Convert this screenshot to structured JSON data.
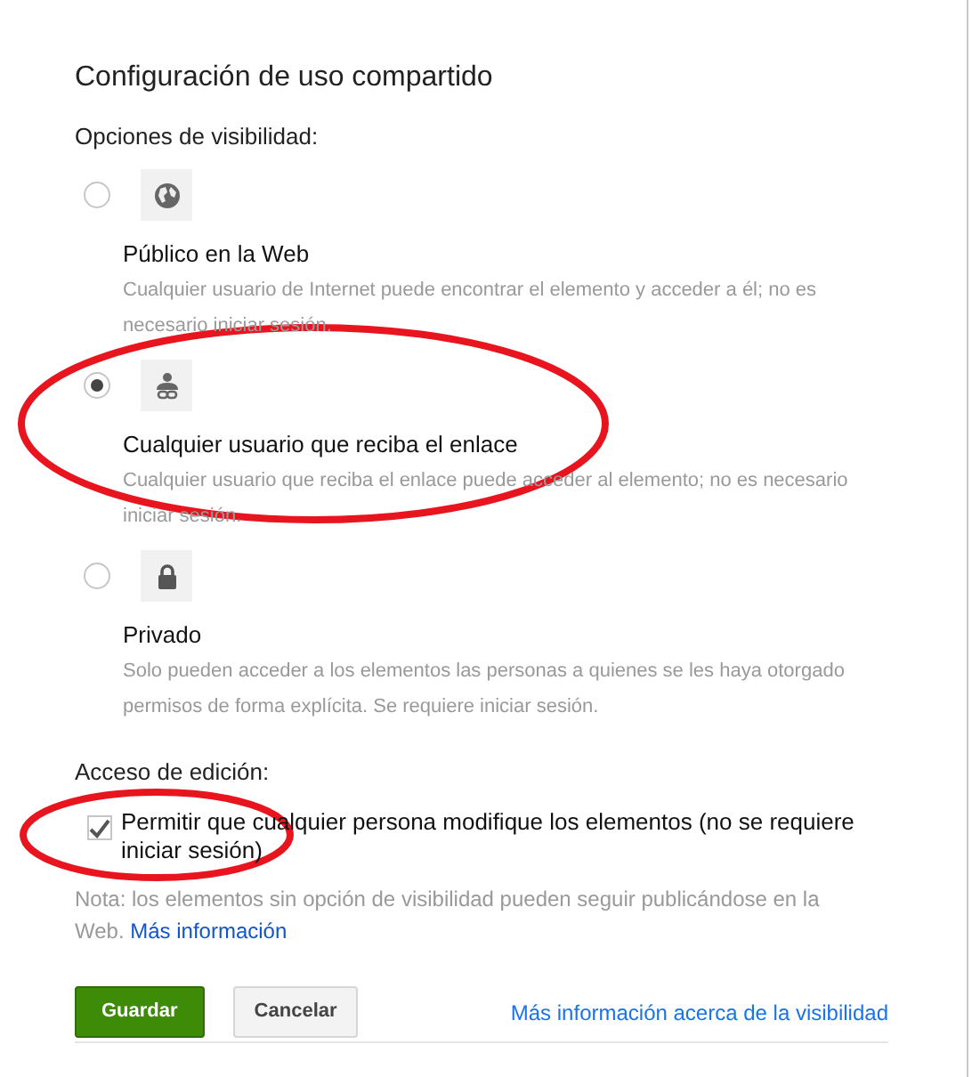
{
  "title": "Configuración de uso compartido",
  "visibility_heading": "Opciones de visibilidad:",
  "options": [
    {
      "kind": "globe",
      "label": "Público en la Web",
      "description": "Cualquier usuario de Internet puede encontrar el elemento y acceder a él; no es necesario iniciar sesión.",
      "selected": false,
      "circled": false
    },
    {
      "kind": "link",
      "label": "Cualquier usuario que reciba el enlace",
      "description": "Cualquier usuario que reciba el enlace puede acceder al elemento; no es necesario iniciar sesión.",
      "selected": true,
      "circled": true
    },
    {
      "kind": "lock",
      "label": "Privado",
      "description": "Solo pueden acceder a los elementos las personas a quienes se les haya otorgado permisos de forma explícita. Se requiere iniciar sesión.",
      "selected": false,
      "circled": false
    }
  ],
  "edit_heading": "Acceso de edición:",
  "edit_checkbox": {
    "label": "Permitir que cualquier persona modifique los elementos (no se requiere iniciar sesión)",
    "checked": true,
    "circled": true
  },
  "note": {
    "text": "Nota: los elementos sin opción de visibilidad pueden seguir publicándose en la Web.",
    "link": "Más información"
  },
  "buttons": [
    {
      "kind": "primary",
      "label": "Guardar"
    },
    {
      "kind": "secondary",
      "label": "Cancelar"
    }
  ],
  "footer_link": "Más información acerca de la visibilidad"
}
